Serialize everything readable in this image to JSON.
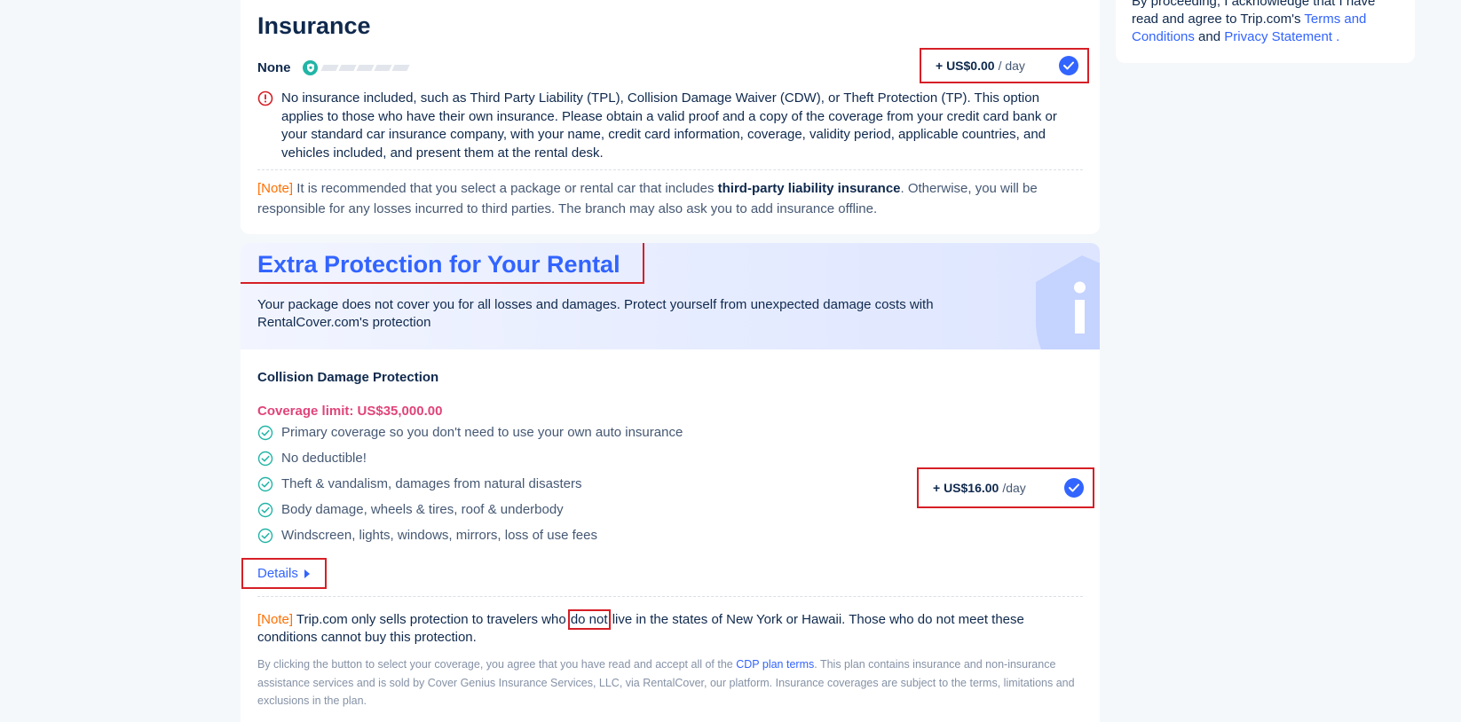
{
  "insurance": {
    "title": "Insurance",
    "option_name": "None",
    "price": "+ US$0.00",
    "price_unit": "/ day",
    "warning": "No insurance included, such as Third Party Liability (TPL), Collision Damage Waiver (CDW), or Theft Protection (TP). This option applies to those who have their own insurance. Please obtain a valid proof and a copy of the coverage from your credit card bank or your standard car insurance company, with your name, credit card information, coverage, validity period, applicable countries, and vehicles included, and present them at the rental desk.",
    "note_tag": "[Note]",
    "note_before": " It is recommended that you select a package or rental car that includes ",
    "note_bold": "third-party liability insurance",
    "note_after": ". Otherwise, you will be responsible for any losses incurred to third parties. The branch may also ask you to add insurance offline."
  },
  "sidebar": {
    "text_before": "By proceeding, I acknowledge that I have read and agree to Trip.com's ",
    "terms_link": "Terms and Conditions",
    "and_text": " and ",
    "privacy_link": "Privacy Statement",
    "text_after": " ."
  },
  "protection": {
    "title": "Extra Protection for Your Rental",
    "description": "Your package does not cover you for all losses and damages. Protect yourself from unexpected damage costs with RentalCover.com's protection",
    "plan_name": "Collision Damage Protection",
    "coverage_limit": "Coverage limit: US$35,000.00",
    "features": [
      "Primary coverage so you don't need to use your own auto insurance",
      "No deductible!",
      "Theft & vandalism, damages from natural disasters",
      "Body damage, wheels & tires, roof & underbody",
      "Windscreen, lights, windows, mirrors, loss of use fees"
    ],
    "price": "+ US$16.00",
    "price_unit": "/day",
    "details_label": "Details",
    "note_tag": "[Note]",
    "note_before": " Trip.com only sells protection to travelers who ",
    "note_highlight": "do not",
    "note_after": " live in the states of New York or Hawaii. Those who do not meet these conditions cannot buy this protection.",
    "legal_before": "By clicking the button to select your coverage, you agree that you have read and accept all of the ",
    "legal_link": "CDP plan terms",
    "legal_after": ". This plan contains insurance and non-insurance assistance services and is sold by Cover Genius Insurance Services, LLC, via RentalCover, our platform. Insurance coverages are subject to the terms, limitations and exclusions in the plan."
  },
  "colors": {
    "accent_blue": "#3264ff",
    "highlight_red": "#d61f26",
    "note_orange": "#ff6f00",
    "coverage_pink": "#e0447a",
    "check_teal": "#21b5a6"
  }
}
